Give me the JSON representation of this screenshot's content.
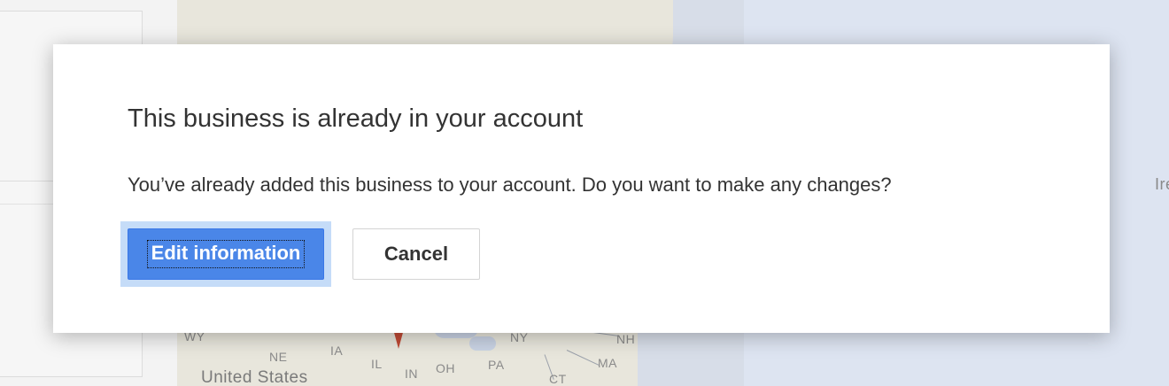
{
  "dialog": {
    "title": "This business is already in your account",
    "message": "You’ve already added this business to your account. Do you want to make any changes?",
    "primary_button": "Edit information",
    "secondary_button": "Cancel"
  },
  "map": {
    "labels": {
      "wy": "WY",
      "ne": "NE",
      "ia": "IA",
      "il": "IL",
      "in": "IN",
      "oh": "OH",
      "pa": "PA",
      "ny": "NY",
      "nh": "NH",
      "ma": "MA",
      "ct": "CT",
      "country": "United States",
      "ire": "Ire"
    }
  },
  "colors": {
    "primary": "#4a86e8",
    "focus_ring": "#c5dcf8",
    "text": "#333333"
  }
}
